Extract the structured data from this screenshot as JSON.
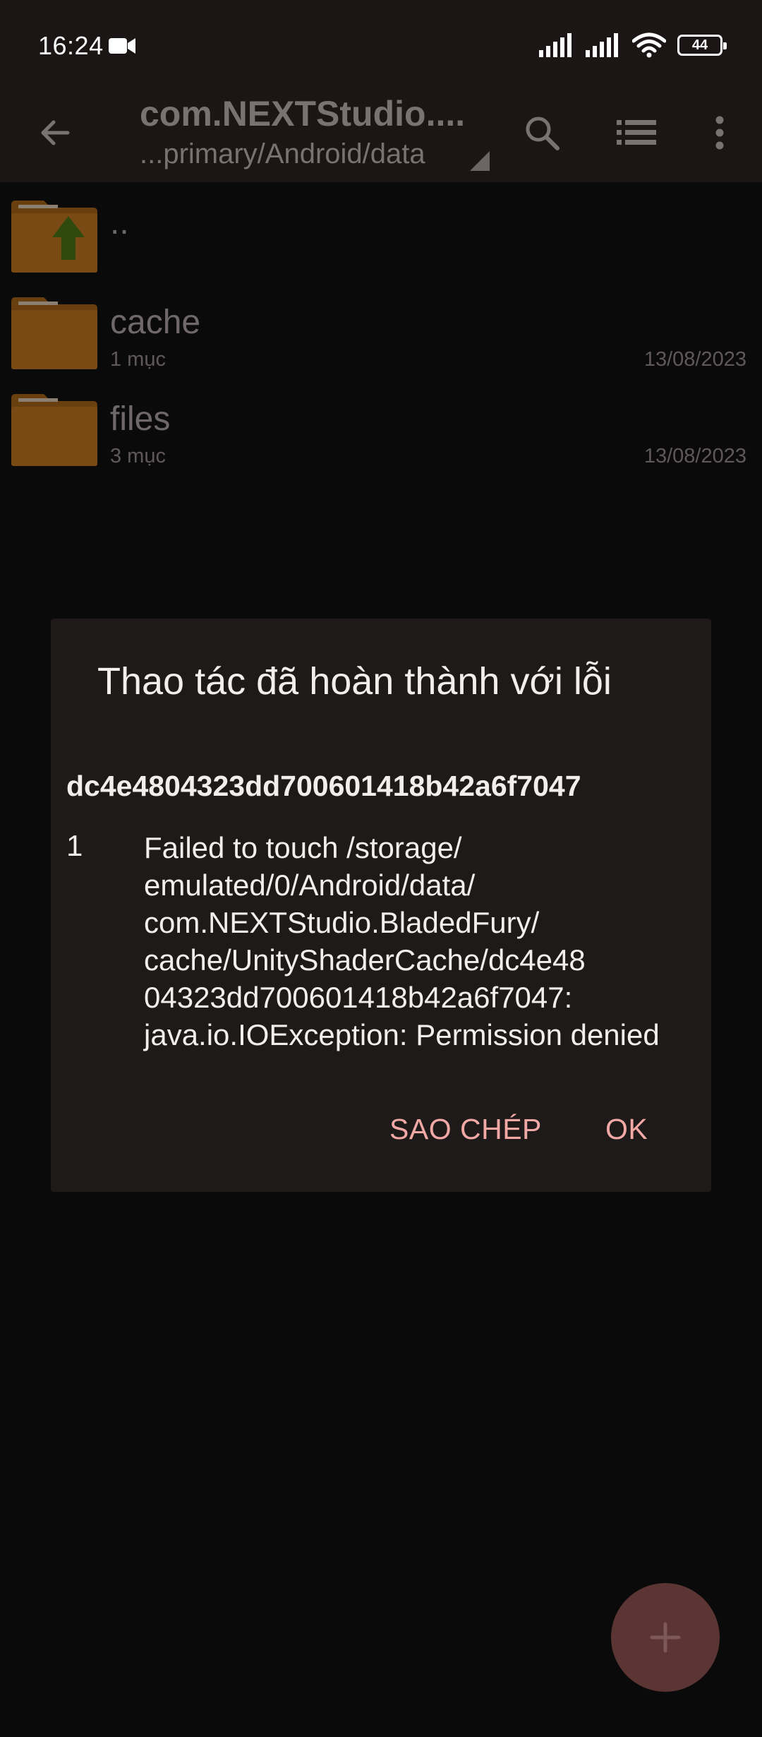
{
  "status_bar": {
    "time": "16:24",
    "battery_level": "44",
    "icons": [
      "video-camera-icon",
      "signal-icon",
      "signal-icon",
      "wifi-icon",
      "battery-icon"
    ]
  },
  "app_bar": {
    "title": "com.NEXTStudio....",
    "subtitle": "...primary/Android/data",
    "icons": [
      "back-arrow-icon",
      "search-icon",
      "list-view-icon",
      "more-vert-icon"
    ]
  },
  "file_list": [
    {
      "name": "..",
      "meta": "",
      "date": "",
      "icon": "folder-up-icon"
    },
    {
      "name": "cache",
      "meta": "1 mục",
      "date": "13/08/2023",
      "icon": "folder-icon"
    },
    {
      "name": "files",
      "meta": "3 mục",
      "date": "13/08/2023",
      "icon": "folder-icon"
    }
  ],
  "dialog": {
    "title": "Thao tác đã hoàn thành với lỗi",
    "hash": "dc4e4804323dd700601418b42a6f7047",
    "error_index": "1",
    "error_lines": [
      "Failed to touch /storage/",
      "emulated/0/Android/data/",
      "com.NEXTStudio.BladedFury/",
      "cache/UnityShaderCache/dc4e48",
      "04323dd700601418b42a6f7047:",
      "java.io.IOException: Permission denied"
    ],
    "copy_label": "SAO CHÉP",
    "ok_label": "OK"
  },
  "fab": {
    "icon": "plus-icon"
  },
  "colors": {
    "background": "#0b0a0a",
    "app_bar": "#1c1515",
    "dialog": "#1f1a1a",
    "accent": "#f2a9a5",
    "folder": "#7a4a14",
    "fab": "#5a3534"
  }
}
